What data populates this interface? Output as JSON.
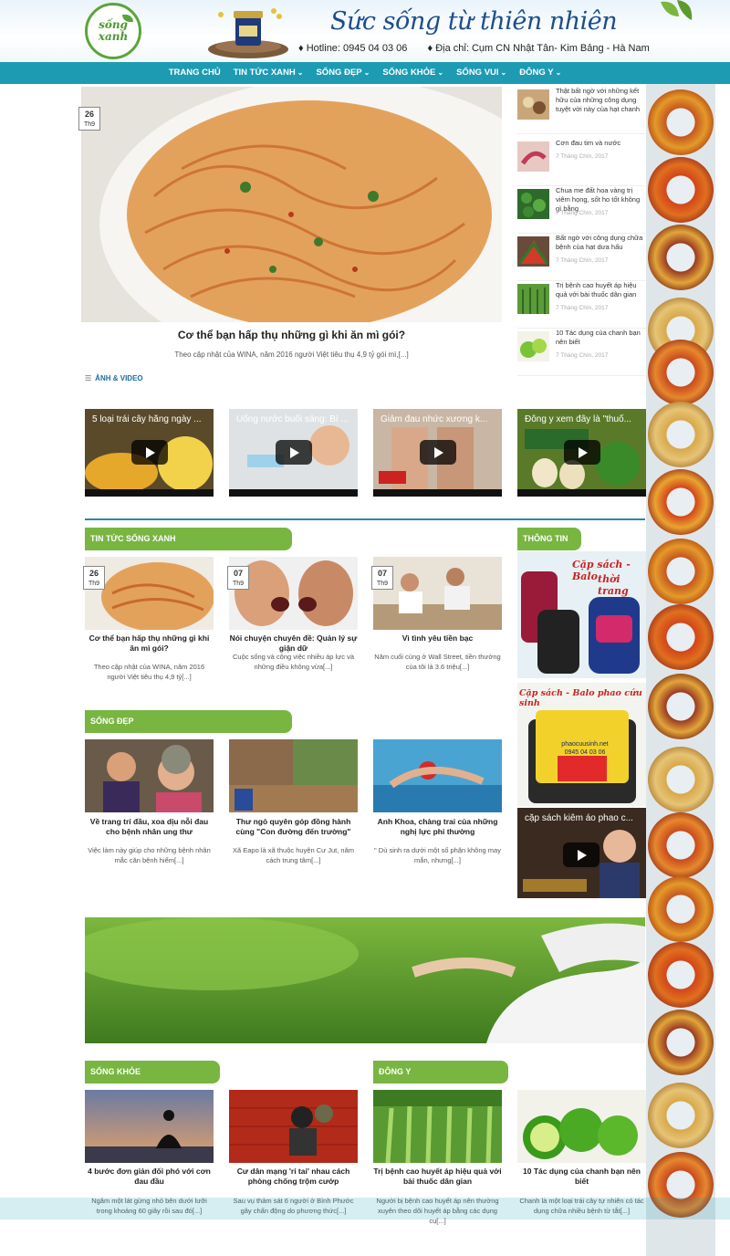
{
  "header": {
    "logo_text_1": "sống",
    "logo_text_2": "xanh",
    "slogan": "Sức sống từ thiên nhiên",
    "hotline": "Hotline: 0945 04 03 06",
    "address": "Địa chỉ: Cụm CN Nhật Tân- Kim Bảng - Hà Nam"
  },
  "nav": {
    "items": [
      {
        "label": "TRANG CHỦ",
        "dropdown": false
      },
      {
        "label": "TIN TỨC XANH",
        "dropdown": true
      },
      {
        "label": "SỐNG ĐẸP",
        "dropdown": true
      },
      {
        "label": "SỐNG KHỎE",
        "dropdown": true
      },
      {
        "label": "SỐNG VUI",
        "dropdown": true
      },
      {
        "label": "ĐÔNG Y",
        "dropdown": true
      }
    ]
  },
  "hero": {
    "day": "26",
    "month": "Th9",
    "title": "Cơ thể bạn hấp thụ những gì khi ăn mì gói?",
    "excerpt": "Theo cập nhật của WINA, năm 2016 người Việt tiêu thụ 4,9 tỷ gói mì,[...]"
  },
  "side_list": [
    {
      "title": "Thật bất ngờ với những kết hữu của những công dụng tuyệt vời này của hạt chanh",
      "date": ""
    },
    {
      "title": "Cơn đau tim và nước",
      "date": "7 Tháng Chín, 2017"
    },
    {
      "title": "Chua me đất hoa vàng trị viêm họng, sốt ho tốt không gì bằng",
      "date": "7 Tháng Chín, 2017"
    },
    {
      "title": "Bất ngờ với công dụng chữa bệnh của hạt dưa hấu",
      "date": "7 Tháng Chín, 2017"
    },
    {
      "title": "Trị bệnh cao huyết áp hiệu quả với bài thuốc dân gian",
      "date": "7 Tháng Chín, 2017"
    },
    {
      "title": "10 Tác dụng của chanh bạn nên biết",
      "date": "7 Tháng Chín, 2017"
    }
  ],
  "videos_section": {
    "title": "ẢNH & VIDEO",
    "videos": [
      {
        "title": "5 loại trái cây hằng ngày ..."
      },
      {
        "title": "Uống nước buổi sáng: Bí ..."
      },
      {
        "title": "Giảm đau nhức xương k..."
      },
      {
        "title": "Đông y xem đây là \"thuố..."
      }
    ]
  },
  "tin_tuc": {
    "title": "TIN TỨC SỐNG XANH",
    "cards": [
      {
        "day": "26",
        "month": "Th9",
        "title": "Cơ thể bạn hấp thụ những gì khi ăn mì gói?",
        "excerpt": "Theo cập nhật của WINA, năm 2016 người Việt tiêu thụ 4,9 tỷ[...]"
      },
      {
        "day": "07",
        "month": "Th9",
        "title": "Nói chuyện chuyên đề: Quản lý sự giận dữ",
        "excerpt": "Cuộc sống và công việc nhiều áp lực và những điều không vừa[...]"
      },
      {
        "day": "07",
        "month": "Th9",
        "title": "Vì tình yêu tiền bạc",
        "excerpt": "Năm cuối cùng ở Wall Street, tiền thưởng của tôi là 3.6 triệu[...]"
      }
    ]
  },
  "thong_tin": {
    "title": "THÔNG TIN",
    "ad1_line1": "Cặp sách - Balo",
    "ad1_line2": "thời trang",
    "ad2_title": "Cặp sách - Balo phao cứu sinh",
    "ad2_web": "phaocuusinh.net",
    "ad2_phone": "0945 04 03 06",
    "video_title": "cặp sách kiêm áo phao c..."
  },
  "song_dep": {
    "title": "SỐNG ĐẸP",
    "cards": [
      {
        "title": "Về trang trí đầu, xoa dịu nỗi đau cho bệnh nhân ung thư",
        "excerpt": "Việc làm này giúp cho những bệnh nhân mắc căn bệnh hiểm[...]"
      },
      {
        "title": "Thư ngỏ quyên góp đồng hành cùng \"Con đường đến trường\"",
        "excerpt": "Xã Eapo là xã thuộc huyện Cư Jut, năm cách trung tâm[...]"
      },
      {
        "title": "Anh Khoa, chàng trai của những nghị lực phi thường",
        "excerpt": "\" Dù sinh ra dưới một số phận không may mắn, nhưng[...]"
      }
    ]
  },
  "song_khoe": {
    "title": "SỐNG KHỎE",
    "cards": [
      {
        "title": "4 bước đơn giản đối phó với cơn đau đầu",
        "excerpt": "Ngâm một lát gừng nhỏ bên dưới lưỡi trong khoảng 60 giây rồi sau đó[...]"
      },
      {
        "title": "Cư dân mạng 'rỉ tai' nhau cách phòng chống trộm cướp",
        "excerpt": "Sau vụ thảm sát 6 người ở Bình Phước gây chấn động do phương thức[...]"
      }
    ]
  },
  "dong_y": {
    "title": "ĐÔNG Y",
    "cards": [
      {
        "title": "Trị bệnh cao huyết áp hiệu quả với bài thuốc dân gian",
        "excerpt": "Người bị bệnh cao huyết áp nên thường xuyên theo dõi huyết áp bằng các dụng cụ[...]"
      },
      {
        "title": "10 Tác dụng của chanh bạn nên biết",
        "excerpt": "Chanh là một loại trái cây tự nhiên có tác dụng chữa nhiều bệnh từ tắt[...]"
      }
    ]
  },
  "colors": {
    "nav_bg": "#1d9bb3",
    "section_green": "#79b541",
    "slogan_blue": "#1d4d8c",
    "divider_blue": "#2a86b0"
  }
}
